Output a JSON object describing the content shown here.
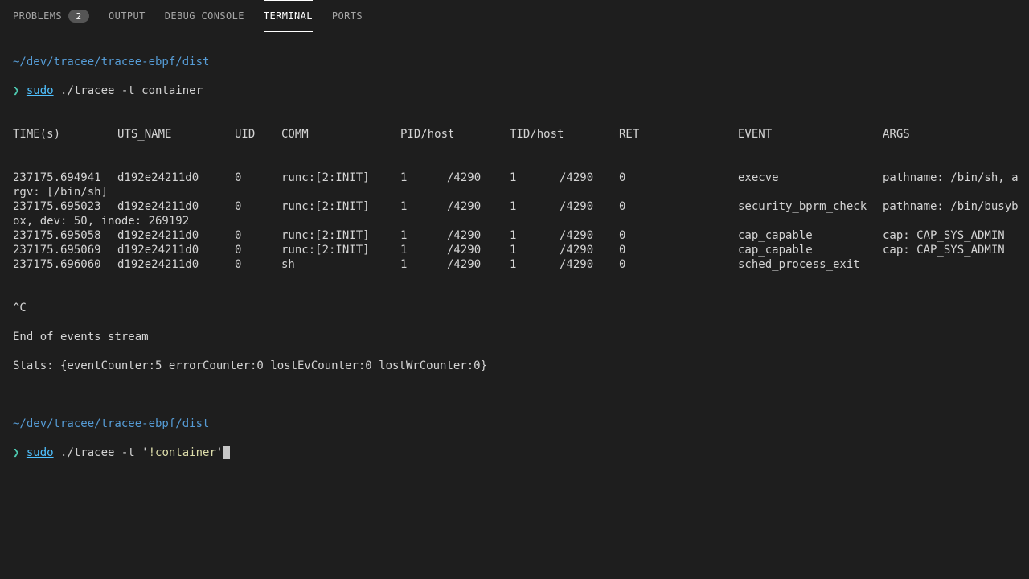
{
  "tabs": {
    "problems": {
      "label": "PROBLEMS",
      "badge": "2"
    },
    "output": {
      "label": "OUTPUT"
    },
    "debug": {
      "label": "DEBUG CONSOLE"
    },
    "terminal": {
      "label": "TERMINAL"
    },
    "ports": {
      "label": "PORTS"
    }
  },
  "prompt": {
    "cwd": "~/dev/tracee/tracee-ebpf/dist",
    "symbol": "❯",
    "sudo": "sudo",
    "cmd1": " ./tracee -t container",
    "cmd2a": " ./tracee -t '",
    "cmd2b": "!container",
    "cmd2c": "'"
  },
  "headers": {
    "time": "TIME(s)",
    "uts": "UTS_NAME",
    "uid": "UID",
    "comm": "COMM",
    "pid": "PID/host",
    "tid": "TID/host",
    "ret": "RET",
    "event": "EVENT",
    "args": "ARGS"
  },
  "rows": [
    {
      "time": "237175.694941",
      "uts": "d192e24211d0",
      "uid": "0",
      "comm": "runc:[2:INIT]",
      "pid": "1",
      "pidh": "/4290",
      "tid": "1",
      "tidh": "/4290",
      "ret": "0",
      "event": "execve",
      "args": "pathname: /bin/sh, a",
      "wrap": "rgv: [/bin/sh]"
    },
    {
      "time": "237175.695023",
      "uts": "d192e24211d0",
      "uid": "0",
      "comm": "runc:[2:INIT]",
      "pid": "1",
      "pidh": "/4290",
      "tid": "1",
      "tidh": "/4290",
      "ret": "0",
      "event": "security_bprm_check",
      "args": "pathname: /bin/busyb",
      "wrap": "ox, dev: 50, inode: 269192"
    },
    {
      "time": "237175.695058",
      "uts": "d192e24211d0",
      "uid": "0",
      "comm": "runc:[2:INIT]",
      "pid": "1",
      "pidh": "/4290",
      "tid": "1",
      "tidh": "/4290",
      "ret": "0",
      "event": "cap_capable",
      "args": "cap: CAP_SYS_ADMIN"
    },
    {
      "time": "237175.695069",
      "uts": "d192e24211d0",
      "uid": "0",
      "comm": "runc:[2:INIT]",
      "pid": "1",
      "pidh": "/4290",
      "tid": "1",
      "tidh": "/4290",
      "ret": "0",
      "event": "cap_capable",
      "args": "cap: CAP_SYS_ADMIN"
    },
    {
      "time": "237175.696060",
      "uts": "d192e24211d0",
      "uid": "0",
      "comm": "sh",
      "pid": "1",
      "pidh": "/4290",
      "tid": "1",
      "tidh": "/4290",
      "ret": "0",
      "event": "sched_process_exit",
      "args": ""
    }
  ],
  "footer": {
    "sigint": "^C",
    "end": "End of events stream",
    "stats": "Stats: {eventCounter:5 errorCounter:0 lostEvCounter:0 lostWrCounter:0}"
  }
}
